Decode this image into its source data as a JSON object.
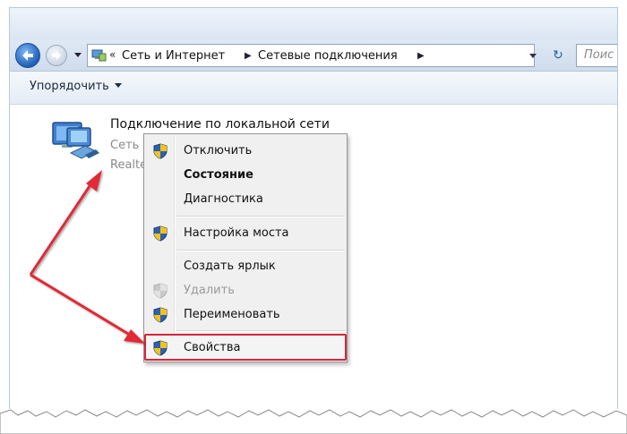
{
  "address_bar": {
    "crumbs": [
      "Сеть и Интернет",
      "Сетевые подключения"
    ],
    "search_placeholder": "Поис"
  },
  "toolbar": {
    "organize_label": "Упорядочить"
  },
  "connection": {
    "title": "Подключение по локальной сети",
    "network": "Сеть",
    "adapter": "Realte"
  },
  "context_menu": {
    "items": [
      {
        "label": "Отключить",
        "icon": "shield-icon"
      },
      {
        "label": "Состояние",
        "bold": true
      },
      {
        "label": "Диагностика"
      },
      {
        "label": "Настройка моста",
        "icon": "shield-icon"
      },
      {
        "label": "Создать ярлык"
      },
      {
        "label": "Удалить",
        "icon": "shield-icon",
        "disabled": true
      },
      {
        "label": "Переименовать",
        "icon": "shield-icon"
      },
      {
        "label": "Свойства",
        "icon": "shield-icon",
        "highlighted": true
      }
    ]
  },
  "colors": {
    "highlight_border": "#d6263c",
    "arrow": "#e02a36",
    "shield_blue": "#2d5fb5",
    "shield_yellow": "#f2c318"
  }
}
